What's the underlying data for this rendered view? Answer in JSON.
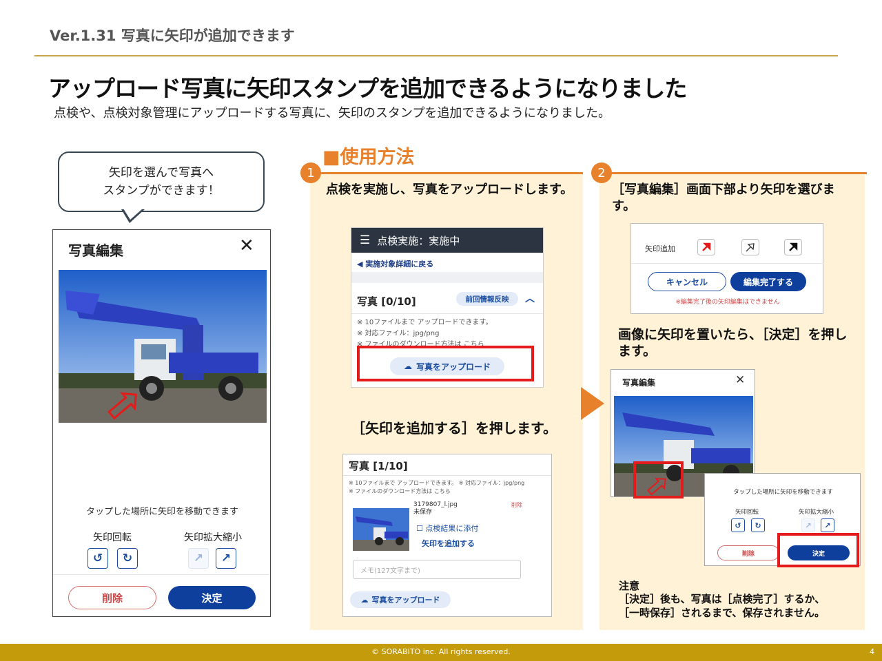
{
  "header": {
    "version": "Ver.1.31 写真に矢印が追加できます",
    "headline": "アップロード写真に矢印スタンプを追加できるようになりました",
    "subline": "点検や、点検対象管理にアップロードする写真に、矢印のスタンプを追加できるようになりました。"
  },
  "bubble": {
    "text": "矢印を選んで写真へ\nスタンプができます！"
  },
  "phone": {
    "title": "写真編集",
    "close": "✕",
    "hint": "タップした場所に矢印を移動できます",
    "rotate_label": "矢印回転",
    "scale_label": "矢印拡大縮小",
    "delete_label": "削除",
    "ok_label": "決定"
  },
  "how_to": {
    "title": "■使用方法"
  },
  "step1": {
    "num": "1",
    "text": "点検を実施し、写真をアップロードします。",
    "text2": "［矢印を追加する］を押します。",
    "screen1": {
      "header": "点検実施：実施中",
      "back": "実施対象詳細に戻る",
      "title": "写真 [0/10]",
      "pill": "前回情報反映",
      "note1": "※ 10ファイルまで アップロードできます。",
      "note2": "※ 対応ファイル：jpg/png",
      "note3": "※ ファイルのダウンロード方法は こちら",
      "upload": "写真をアップロード"
    },
    "screen2": {
      "title": "写真 [1/10]",
      "note1": "※ 10ファイルまで アップロードできます。 ※ 対応ファイル：jpg/png",
      "note2": "※ ファイルのダウンロード方法は こちら",
      "file_name": "3179807_l.jpg",
      "file_status": "未保存",
      "delete": "削除",
      "checkbox": "点検結果に添付",
      "add_arrow": "矢印を追加する",
      "memo_placeholder": "メモ(127文字まで)",
      "upload": "写真をアップロード"
    }
  },
  "step2": {
    "num": "2",
    "text": "［写真編集］画面下部より矢印を選びます。",
    "text2": "画像に矢印を置いたら、［決定］を押します。",
    "screen3": {
      "label": "矢印追加",
      "cancel": "キャンセル",
      "done": "編集完了する",
      "note": "※編集完了後の矢印編集はできません"
    },
    "screen4": {
      "title": "写真編集",
      "close": "✕"
    },
    "screen5": {
      "hint": "タップした場所に矢印を移動できます",
      "rotate_label": "矢印回転",
      "scale_label": "矢印拡大縮小",
      "delete": "削除",
      "ok": "決定"
    },
    "note_title": "注意",
    "note_body": "［決定］後も、写真は［点検完了］するか、\n［一時保存］されるまで、保存されません。"
  },
  "footer": {
    "copyright": "© SORABITO inc. All rights reserved.",
    "page": "4"
  },
  "colors": {
    "accent": "#e8812c",
    "gold": "#c39b0b",
    "primary": "#0e3f9c",
    "danger": "#e31b1b",
    "panel": "#fff2d6"
  }
}
